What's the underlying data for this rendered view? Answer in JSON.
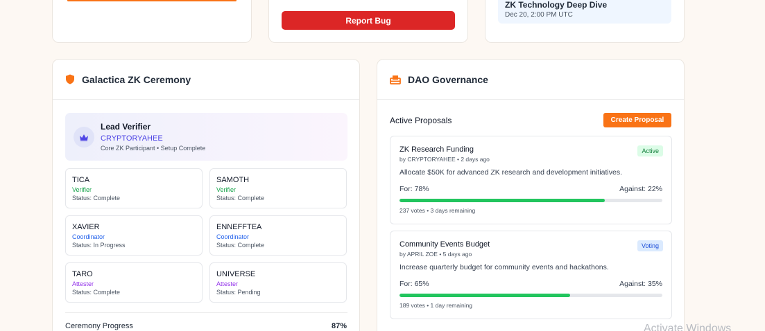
{
  "top_cards": {
    "report_bug_label": "Report Bug",
    "event_title": "ZK Technology Deep Dive",
    "event_date": "Dec 20, 2:00 PM UTC"
  },
  "ceremony": {
    "title": "Galactica ZK Ceremony",
    "icon": "shield-icon",
    "lead": {
      "icon": "crown-icon",
      "title": "Lead Verifier",
      "name": "CRYPTORYAHEE",
      "description": "Core ZK Participant • Setup Complete"
    },
    "members": [
      {
        "name": "TICA",
        "role": "Verifier",
        "status": "Status: Complete"
      },
      {
        "name": "SAMOTH",
        "role": "Verifier",
        "status": "Status: Complete"
      },
      {
        "name": "XAVIER",
        "role": "Coordinator",
        "status": "Status: In Progress"
      },
      {
        "name": "ENNEFFTEA",
        "role": "Coordinator",
        "status": "Status: Complete"
      },
      {
        "name": "TARO",
        "role": "Attester",
        "status": "Status: Complete"
      },
      {
        "name": "UNIVERSE",
        "role": "Attester",
        "status": "Status: Pending"
      }
    ],
    "progress_label": "Ceremony Progress",
    "progress_value": "87%"
  },
  "dao": {
    "title": "DAO Governance",
    "icon": "ballot-box-icon",
    "active_label": "Active Proposals",
    "create_label": "Create Proposal",
    "proposals": [
      {
        "title": "ZK Research Funding",
        "author": "by CRYPTORYAHEE • 2 days ago",
        "badge": "Active",
        "description": "Allocate $50K for advanced ZK research and development initiatives.",
        "for_label": "For: 78%",
        "against_label": "Against: 22%",
        "for_pct": 78,
        "meta": "237 votes • 3 days remaining"
      },
      {
        "title": "Community Events Budget",
        "author": "by APRIL ZOE • 5 days ago",
        "badge": "Voting",
        "description": "Increase quarterly budget for community events and hackathons.",
        "for_label": "For: 65%",
        "against_label": "Against: 35%",
        "for_pct": 65,
        "meta": "189 votes • 1 day remaining"
      }
    ]
  },
  "colors": {
    "accent": "#f97316",
    "danger": "#dc2626",
    "success": "#22c55e",
    "lead_name": "#4f46e5"
  },
  "watermark": "Activate Windows"
}
